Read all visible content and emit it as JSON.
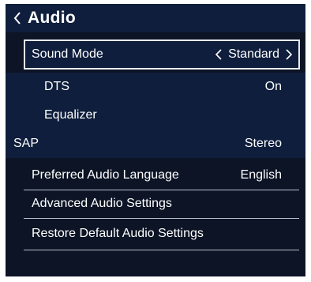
{
  "header": {
    "title": "Audio",
    "back_icon": "chevron-left-icon"
  },
  "colors": {
    "background": "#0c1425",
    "band": "#0f1e3c",
    "accent_title": "#ffffff",
    "divider": "#b9bec8"
  },
  "menu": {
    "sound_mode": {
      "label": "Sound Mode",
      "value": "Standard"
    },
    "dts": {
      "label": "DTS",
      "value": "On"
    },
    "equalizer": {
      "label": "Equalizer"
    },
    "sap": {
      "label": "SAP",
      "value": "Stereo"
    },
    "preferred_language": {
      "label": "Preferred Audio Language",
      "value": "English"
    },
    "advanced": {
      "label": "Advanced Audio Settings"
    },
    "restore": {
      "label": "Restore Default Audio Settings"
    }
  }
}
